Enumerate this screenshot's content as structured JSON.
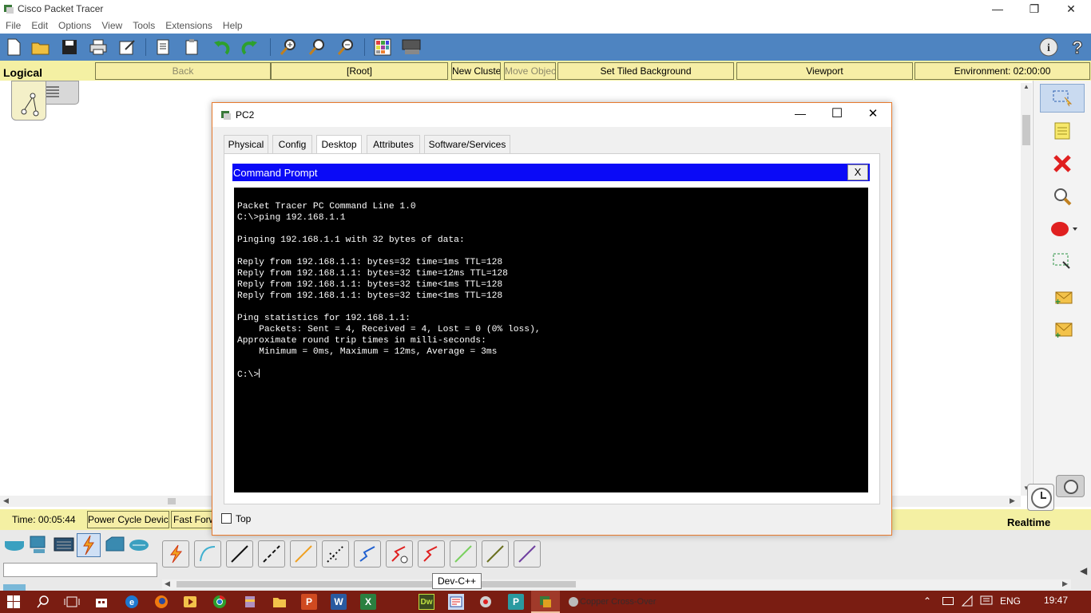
{
  "window": {
    "title": "Cisco Packet Tracer",
    "controls": {
      "minimize": "—",
      "maximize": "❐",
      "close": "✕"
    }
  },
  "menu": [
    "File",
    "Edit",
    "Options",
    "View",
    "Tools",
    "Extensions",
    "Help"
  ],
  "toolbar": {
    "icons": [
      "new-file-icon",
      "open-folder-icon",
      "save-icon",
      "print-icon",
      "activity-wizard-icon",
      "copy-icon",
      "paste-icon",
      "undo-icon",
      "redo-icon",
      "zoom-in-icon",
      "zoom-reset-icon",
      "zoom-out-icon",
      "palette-icon",
      "custom-device-icon",
      "info-icon",
      "help-icon"
    ]
  },
  "logical_bar": {
    "label": "Logical",
    "back": "Back",
    "root": "[Root]",
    "new_cluster": "New Cluster",
    "move_object": "Move Object",
    "set_tiled_background": "Set Tiled Background",
    "viewport": "Viewport",
    "environment": "Environment: 02:00:00"
  },
  "status_bar": {
    "time": "Time: 00:05:44",
    "power_cycle": "Power Cycle Devices",
    "fast_forward": "Fast Forwa",
    "realtime": "Realtime"
  },
  "dialog": {
    "title": "PC2",
    "controls": {
      "minimize": "—",
      "maximize": "☐",
      "close": "✕"
    },
    "tabs": [
      "Physical",
      "Config",
      "Desktop",
      "Attributes",
      "Software/Services"
    ],
    "active_tab": "Desktop",
    "command_prompt": {
      "title": "Command Prompt",
      "close": "X",
      "lines": [
        "Packet Tracer PC Command Line 1.0",
        "C:\\>ping 192.168.1.1",
        "",
        "Pinging 192.168.1.1 with 32 bytes of data:",
        "",
        "Reply from 192.168.1.1: bytes=32 time=1ms TTL=128",
        "Reply from 192.168.1.1: bytes=32 time=12ms TTL=128",
        "Reply from 192.168.1.1: bytes=32 time<1ms TTL=128",
        "Reply from 192.168.1.1: bytes=32 time<1ms TTL=128",
        "",
        "Ping statistics for 192.168.1.1:",
        "    Packets: Sent = 4, Received = 4, Lost = 0 (0% loss),",
        "Approximate round trip times in milli-seconds:",
        "    Minimum = 0ms, Maximum = 12ms, Average = 3ms",
        ""
      ],
      "prompt": "C:\\>"
    },
    "top_checkbox": "Top"
  },
  "tooltip": "Dev-C++",
  "taskbar": {
    "app_label": "Copper Cross-Over",
    "language": "ENG",
    "clock": "19:47"
  },
  "colors": {
    "toolbar_blue": "#4e84c1",
    "yellow_bar": "#f4f0a3",
    "cmd_title_blue": "#0a0af7",
    "taskbar_red": "#7a1d12",
    "dialog_border": "#e77a2d"
  }
}
